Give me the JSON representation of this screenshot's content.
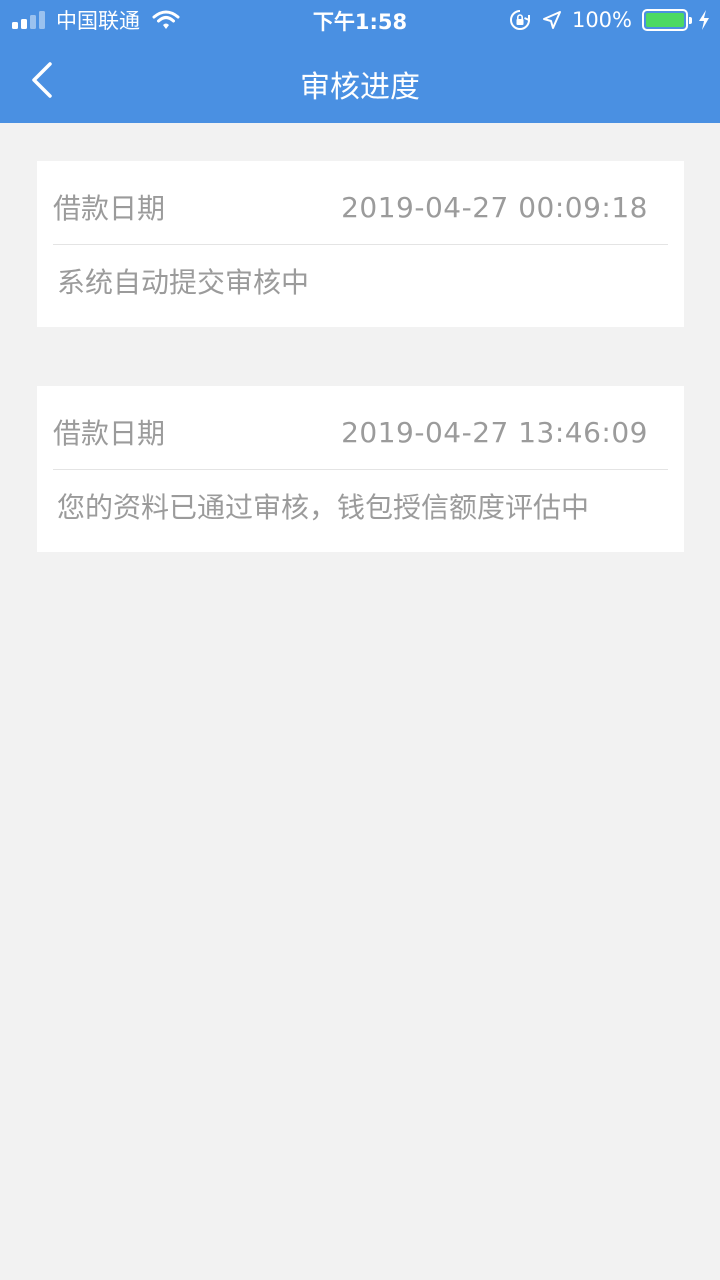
{
  "status_bar": {
    "carrier": "中国联通",
    "time": "下午1:58",
    "battery": "100%"
  },
  "nav": {
    "title": "审核进度"
  },
  "records": [
    {
      "label": "借款日期",
      "datetime": "2019-04-27 00:09:18",
      "status": "系统自动提交审核中"
    },
    {
      "label": "借款日期",
      "datetime": "2019-04-27 13:46:09",
      "status": "您的资料已通过审核，钱包授信额度评估中"
    }
  ],
  "colors": {
    "header": "#4a90e2",
    "background": "#f2f2f2",
    "card": "#ffffff",
    "text_gray": "#9b9b9b",
    "battery_fill": "#4cd964"
  },
  "icons": [
    "signal-icon",
    "wifi-icon",
    "rotation-lock-icon",
    "location-icon",
    "battery-icon",
    "charging-icon",
    "back-chevron-icon"
  ]
}
